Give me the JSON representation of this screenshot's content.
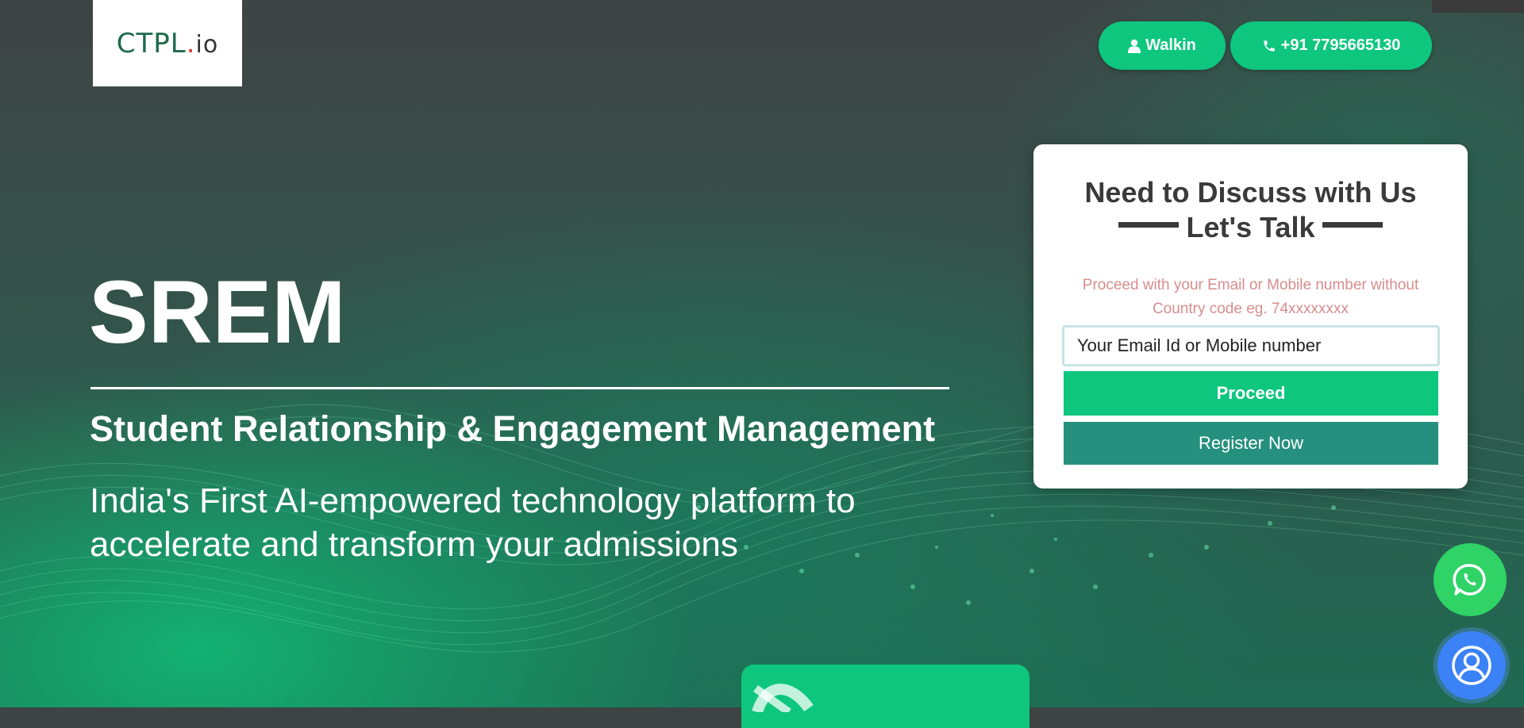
{
  "header": {
    "logo": {
      "main": "CTPL",
      "dot": ".",
      "suffix": "io"
    },
    "walkin_label": "Walkin",
    "phone_label": "+91 7795665130"
  },
  "hero": {
    "title": "SREM",
    "subtitle": "Student Relationship & Engagement Management",
    "description": "India's First AI-empowered technology platform to accelerate and transform your admissions"
  },
  "form": {
    "title_line1": "Need to Discuss with Us",
    "title_line2": "Let's Talk",
    "hint": "Proceed with your Email or Mobile number without Country code eg. 74xxxxxxxx",
    "input_placeholder": "Your Email Id or Mobile number",
    "input_value": "",
    "proceed_label": "Proceed",
    "register_label": "Register Now"
  },
  "floating": {
    "whatsapp_icon": "whatsapp-icon",
    "chat_icon": "user-circle-icon"
  },
  "colors": {
    "accent": "#0ec67e",
    "register": "#26907e",
    "whatsapp": "#2fd366",
    "chat": "#3b82f6"
  }
}
